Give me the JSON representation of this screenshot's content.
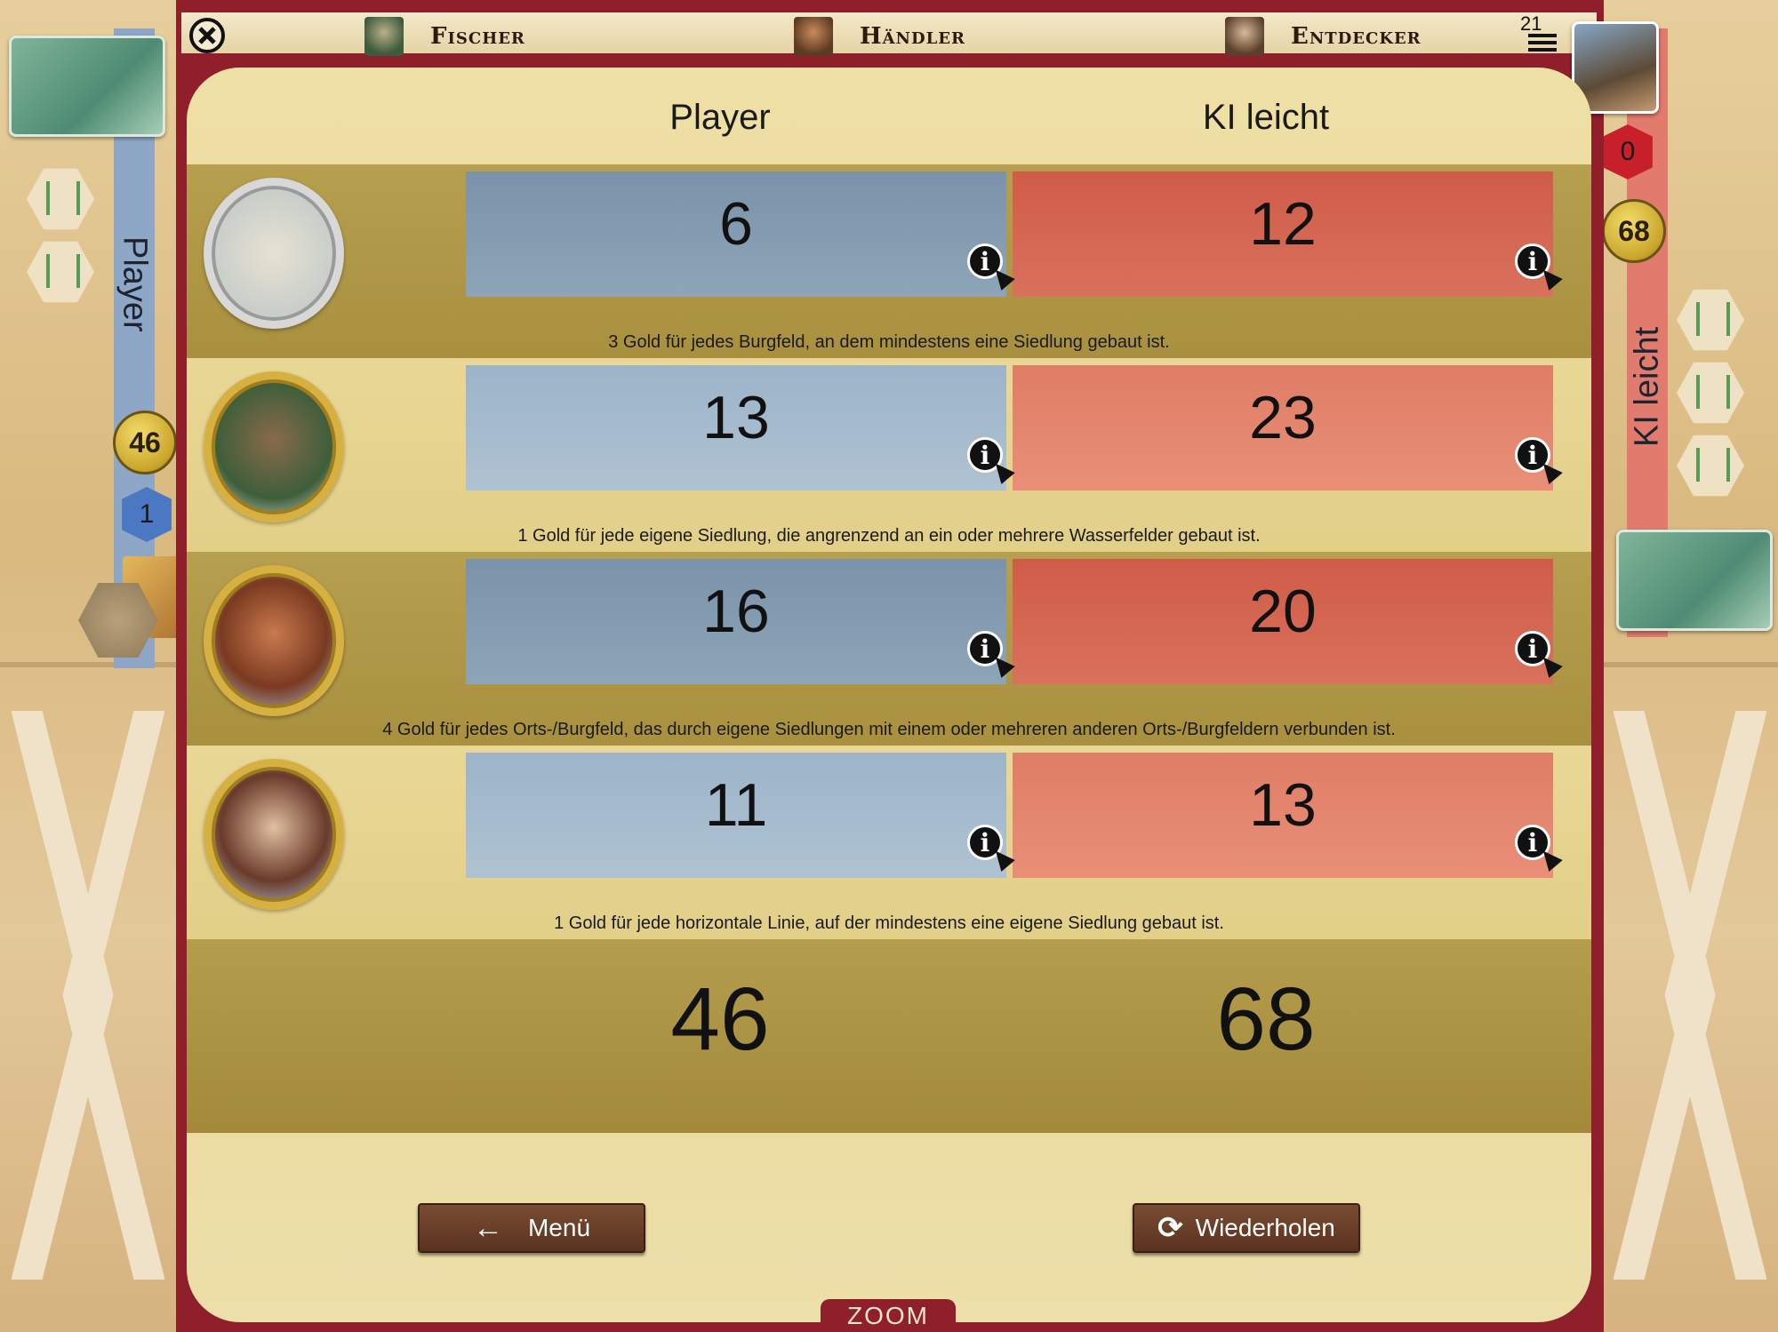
{
  "top_bar": {
    "roles": [
      {
        "label": "Fischer"
      },
      {
        "label": "Händler"
      },
      {
        "label": "Entdecker"
      }
    ],
    "round_number": "21"
  },
  "left_player": {
    "name": "Player",
    "gold": "46",
    "settlements_left": "1"
  },
  "right_player": {
    "name": "KI leicht",
    "gold": "68",
    "settlements_left": "0"
  },
  "score_table": {
    "headers": [
      "Player",
      "KI leicht"
    ],
    "rows": [
      {
        "category": "castle",
        "player": "6",
        "ai": "12",
        "description": "3 Gold für jedes Burgfeld, an dem mindestens eine Siedlung gebaut ist."
      },
      {
        "category": "fischer",
        "player": "13",
        "ai": "23",
        "description": "1 Gold für jede eigene Siedlung, die angrenzend an ein oder mehrere Wasserfelder gebaut ist."
      },
      {
        "category": "haendler",
        "player": "16",
        "ai": "20",
        "description": "4 Gold für jedes Orts-/Burgfeld, das durch eigene Siedlungen mit einem oder mehreren anderen Orts-/Burgfeldern verbunden ist."
      },
      {
        "category": "entdecker",
        "player": "11",
        "ai": "13",
        "description": "1 Gold für jede horizontale Linie, auf der mindestens eine eigene Siedlung gebaut ist."
      }
    ],
    "totals": {
      "player": "46",
      "ai": "68"
    }
  },
  "buttons": {
    "menu": "Menü",
    "retry": "Wiederholen",
    "zoom": "ZOOM"
  },
  "colors": {
    "frame": "#8f1f2a",
    "player_blue": "#8ea5b8",
    "ai_red": "#d9715c"
  }
}
